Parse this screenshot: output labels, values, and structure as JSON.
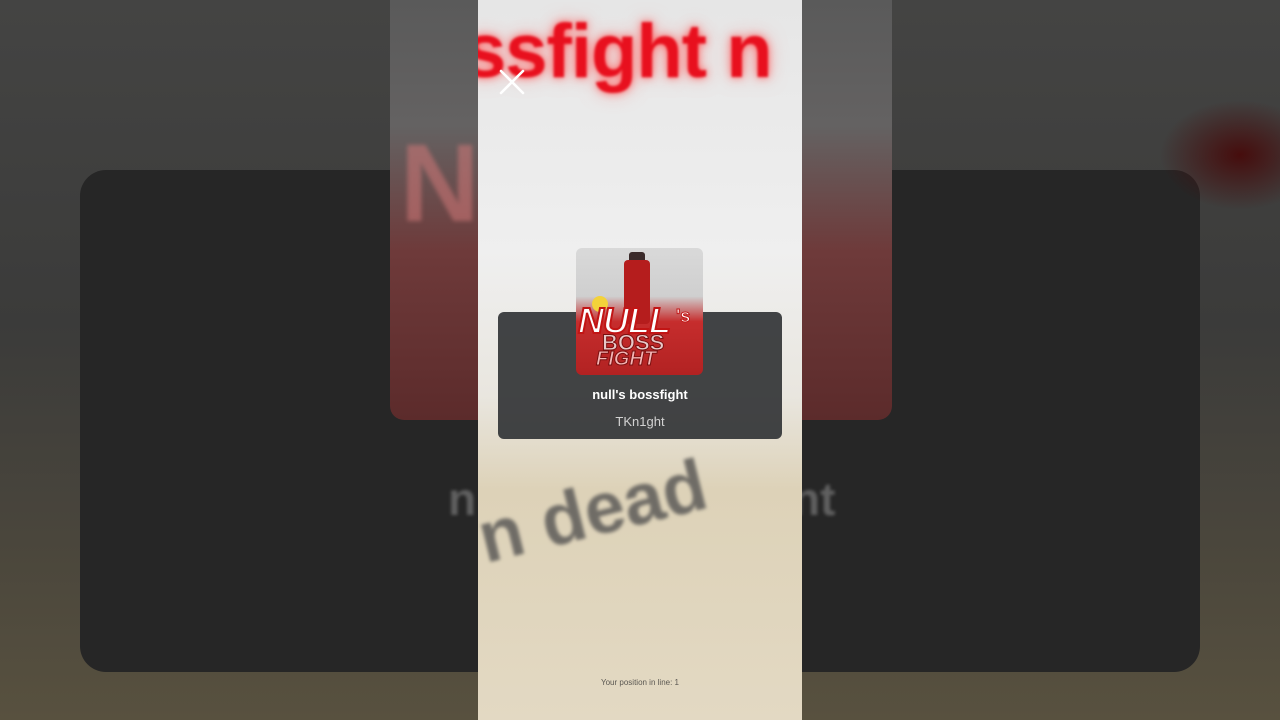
{
  "background": {
    "left_panel_blur_text": "n",
    "right_panel_blur_text": "nt"
  },
  "phone": {
    "top_blur_text": "ssfight n",
    "bottom_blur_text": "n dead"
  },
  "close_icon": "close-icon",
  "game_card": {
    "thumbnail_text": {
      "null": "NULL",
      "possessive": "'s",
      "boss": "BOSS",
      "fight": "FIGHT"
    },
    "title": "null's bossfight",
    "creator": "TKn1ght"
  },
  "queue": {
    "status_text": "Your position in line: 1"
  },
  "colors": {
    "card_bg": "#343638",
    "title_text": "#ffffff",
    "creator_text": "#d2d2d2",
    "accent_red": "#e8101e"
  }
}
